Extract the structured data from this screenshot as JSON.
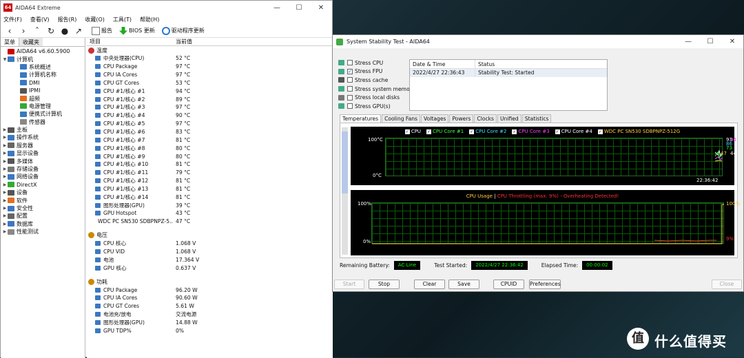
{
  "main": {
    "title": "AIDA64 Extreme",
    "menu": [
      "文件(F)",
      "查看(V)",
      "报告(R)",
      "收藏(O)",
      "工具(T)",
      "帮助(H)"
    ],
    "toolbar": {
      "report": "报告",
      "bios": "BIOS 更新",
      "driver": "驱动程序更新"
    },
    "left_tabs": [
      "菜单",
      "收藏夹"
    ],
    "tree": [
      {
        "label": "AIDA64 v6.60.5900",
        "level": 0,
        "arrow": "",
        "color": "#c00"
      },
      {
        "label": "计算机",
        "level": 0,
        "arrow": "▼",
        "color": "#3b78c2"
      },
      {
        "label": "系统概述",
        "level": 2,
        "arrow": "",
        "color": "#3b78c2"
      },
      {
        "label": "计算机名称",
        "level": 2,
        "arrow": "",
        "color": "#3b78c2"
      },
      {
        "label": "DMI",
        "level": 2,
        "arrow": "",
        "color": "#3b78c2"
      },
      {
        "label": "IPMI",
        "level": 2,
        "arrow": "",
        "color": "#555"
      },
      {
        "label": "超频",
        "level": 2,
        "arrow": "",
        "color": "#e07020"
      },
      {
        "label": "电源管理",
        "level": 2,
        "arrow": "",
        "color": "#3a3"
      },
      {
        "label": "便携式计算机",
        "level": 2,
        "arrow": "",
        "color": "#3b78c2"
      },
      {
        "label": "传感器",
        "level": 2,
        "arrow": "",
        "color": "#888"
      },
      {
        "label": "主板",
        "level": 0,
        "arrow": "▶",
        "color": "#555"
      },
      {
        "label": "操作系统",
        "level": 0,
        "arrow": "▶",
        "color": "#3b78c2"
      },
      {
        "label": "服务器",
        "level": 0,
        "arrow": "▶",
        "color": "#666"
      },
      {
        "label": "显示设备",
        "level": 0,
        "arrow": "▶",
        "color": "#3b78c2"
      },
      {
        "label": "多媒体",
        "level": 0,
        "arrow": "▶",
        "color": "#555"
      },
      {
        "label": "存储设备",
        "level": 0,
        "arrow": "▶",
        "color": "#777"
      },
      {
        "label": "网络设备",
        "level": 0,
        "arrow": "▶",
        "color": "#3b78c2"
      },
      {
        "label": "DirectX",
        "level": 0,
        "arrow": "▶",
        "color": "#3a3"
      },
      {
        "label": "设备",
        "level": 0,
        "arrow": "▶",
        "color": "#555"
      },
      {
        "label": "软件",
        "level": 0,
        "arrow": "▶",
        "color": "#e07020"
      },
      {
        "label": "安全性",
        "level": 0,
        "arrow": "▶",
        "color": "#3b78c2"
      },
      {
        "label": "配置",
        "level": 0,
        "arrow": "▶",
        "color": "#666"
      },
      {
        "label": "数据库",
        "level": 0,
        "arrow": "▶",
        "color": "#3b78c2"
      },
      {
        "label": "性能测试",
        "level": 0,
        "arrow": "▶",
        "color": "#888"
      }
    ],
    "columns": [
      "项目",
      "当前值"
    ],
    "sections": [
      {
        "title": "温度",
        "color": "#c33",
        "rows": [
          [
            "中央处理器(CPU)",
            "52 °C"
          ],
          [
            "CPU Package",
            "97 °C"
          ],
          [
            "CPU IA Cores",
            "97 °C"
          ],
          [
            "CPU GT Cores",
            "53 °C"
          ],
          [
            "CPU #1/核心 #1",
            "94 °C"
          ],
          [
            "CPU #1/核心 #2",
            "89 °C"
          ],
          [
            "CPU #1/核心 #3",
            "97 °C"
          ],
          [
            "CPU #1/核心 #4",
            "90 °C"
          ],
          [
            "CPU #1/核心 #5",
            "97 °C"
          ],
          [
            "CPU #1/核心 #6",
            "83 °C"
          ],
          [
            "CPU #1/核心 #7",
            "81 °C"
          ],
          [
            "CPU #1/核心 #8",
            "80 °C"
          ],
          [
            "CPU #1/核心 #9",
            "80 °C"
          ],
          [
            "CPU #1/核心 #10",
            "81 °C"
          ],
          [
            "CPU #1/核心 #11",
            "79 °C"
          ],
          [
            "CPU #1/核心 #12",
            "81 °C"
          ],
          [
            "CPU #1/核心 #13",
            "81 °C"
          ],
          [
            "CPU #1/核心 #14",
            "81 °C"
          ],
          [
            "图形处理器(GPU)",
            "39 °C"
          ],
          [
            "GPU Hotspot",
            "43 °C"
          ],
          [
            "WDC PC SN530 SDBPNPZ-5...",
            "47 °C"
          ]
        ]
      },
      {
        "title": "电压",
        "color": "#c80",
        "rows": [
          [
            "CPU 核心",
            "1.068 V"
          ],
          [
            "CPU VID",
            "1.068 V"
          ],
          [
            "电池",
            "17.364 V"
          ],
          [
            "GPU 核心",
            "0.637 V"
          ]
        ]
      },
      {
        "title": "功耗",
        "color": "#c80",
        "rows": [
          [
            "CPU Package",
            "96.20 W"
          ],
          [
            "CPU IA Cores",
            "90.60 W"
          ],
          [
            "CPU GT Cores",
            "5.61 W"
          ],
          [
            "电池充/放电",
            "交流电源"
          ],
          [
            "图形处理器(GPU)",
            "14.88 W"
          ],
          [
            "GPU TDP%",
            "0%"
          ]
        ]
      }
    ]
  },
  "stability": {
    "title": "System Stability Test - AIDA64",
    "stress": [
      {
        "label": "Stress CPU",
        "checked": false
      },
      {
        "label": "Stress FPU",
        "checked": true
      },
      {
        "label": "Stress cache",
        "checked": false
      },
      {
        "label": "Stress system memory",
        "checked": false
      },
      {
        "label": "Stress local disks",
        "checked": false
      },
      {
        "label": "Stress GPU(s)",
        "checked": false
      }
    ],
    "status_table": {
      "headers": [
        "Date & Time",
        "Status"
      ],
      "rows": [
        [
          "2022/4/27 22:36:43",
          "Stability Test: Started"
        ]
      ]
    },
    "tabs": [
      "Temperatures",
      "Cooling Fans",
      "Voltages",
      "Powers",
      "Clocks",
      "Unified",
      "Statistics"
    ],
    "temp_graph": {
      "legend": [
        {
          "name": "CPU",
          "color": "#ffffff"
        },
        {
          "name": "CPU Core #1",
          "color": "#40ff40"
        },
        {
          "name": "CPU Core #2",
          "color": "#40e0ff"
        },
        {
          "name": "CPU Core #3",
          "color": "#ff40ff"
        },
        {
          "name": "CPU Core #4",
          "color": "#ffffff"
        },
        {
          "name": "WDC PC SN530 SDBPNPZ-512G",
          "color": "#ffd040"
        }
      ],
      "ytop": "100°C",
      "ybot": "0°C",
      "time": "22:36:42",
      "readings": [
        {
          "text": "93",
          "color": "#ffffff"
        },
        {
          "text": "94",
          "color": "#ff40ff"
        },
        {
          "text": "86",
          "color": "#40e0ff"
        },
        {
          "text": "73",
          "color": "#40ff40"
        },
        {
          "text": "47",
          "color": "#ffd040"
        },
        {
          "text": "44",
          "color": "#ffffff"
        }
      ]
    },
    "usage_graph": {
      "title_usage": "CPU Usage",
      "sep": "|",
      "title_throttle": "CPU Throttling (max: 9%) - Overheating Detected!",
      "ytop": "100%",
      "ybot": "0%",
      "val_usage": "100%",
      "val_throttle": "9%"
    },
    "info": {
      "battery_label": "Remaining Battery:",
      "battery": "AC Line",
      "started_label": "Test Started:",
      "started": "2022/4/27 22:36:42",
      "elapsed_label": "Elapsed Time:",
      "elapsed": "00:00:02"
    },
    "buttons": {
      "start": "Start",
      "stop": "Stop",
      "clear": "Clear",
      "save": "Save",
      "cpuid": "CPUID",
      "prefs": "Preferences",
      "close": "Close"
    }
  },
  "watermark": {
    "logo": "值",
    "text": "什么值得买"
  }
}
